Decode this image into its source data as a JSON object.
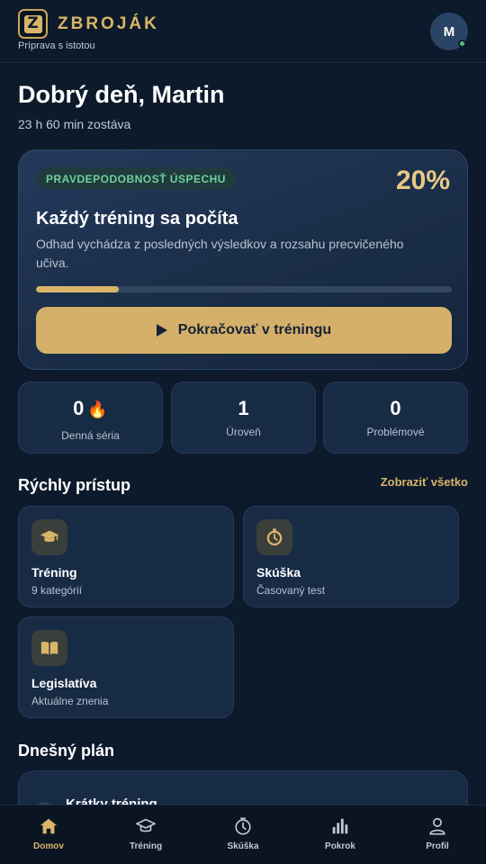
{
  "app": {
    "logo_letter": "Z",
    "name": "ZBROJÁK",
    "tagline": "Príprava s istotou",
    "avatar_initial": "M"
  },
  "greeting": {
    "title": "Dobrý deň, Martin",
    "subtitle": "23 h 60 min zostáva"
  },
  "hero": {
    "badge": "PRAVDEPODOBNOSŤ ÚSPECHU",
    "percent_label": "20%",
    "progress": 0.2,
    "title": "Každý tréning sa počíta",
    "description": "Odhad vychádza z posledných výsledkov a rozsahu precvičeného učiva.",
    "button_label": "Pokračovať v tréningu"
  },
  "stats": [
    {
      "value": "0",
      "icon": "fire-icon",
      "label": "Denná séria"
    },
    {
      "value": "1",
      "label": "Úroveň"
    },
    {
      "value": "0",
      "label": "Problémové"
    }
  ],
  "quick_access": {
    "title": "Rýchly prístup",
    "see_all": "Zobraziť všetko",
    "tiles": [
      {
        "title": "Tréning",
        "subtitle": "9 kategórií",
        "icon": "graduation-cap-icon"
      },
      {
        "title": "Skúška",
        "subtitle": "Časovaný test",
        "icon": "stopwatch-icon"
      },
      {
        "title": "Legislatíva",
        "subtitle": "Aktuálne znenia",
        "icon": "book-icon"
      }
    ]
  },
  "plan": {
    "title": "Dnešný plán",
    "first_item": "Krátky tréning"
  },
  "nav": [
    {
      "label": "Domov",
      "icon": "home-icon",
      "active": true
    },
    {
      "label": "Tréning",
      "icon": "graduation-cap-icon",
      "active": false
    },
    {
      "label": "Skúška",
      "icon": "stopwatch-icon",
      "active": false
    },
    {
      "label": "Pokrok",
      "icon": "bar-chart-icon",
      "active": false
    },
    {
      "label": "Profil",
      "icon": "user-icon",
      "active": false
    }
  ],
  "colors": {
    "background": "#0d1a2b",
    "accent": "#d9b56a",
    "success": "#6fd19b",
    "card": "#182b45"
  }
}
